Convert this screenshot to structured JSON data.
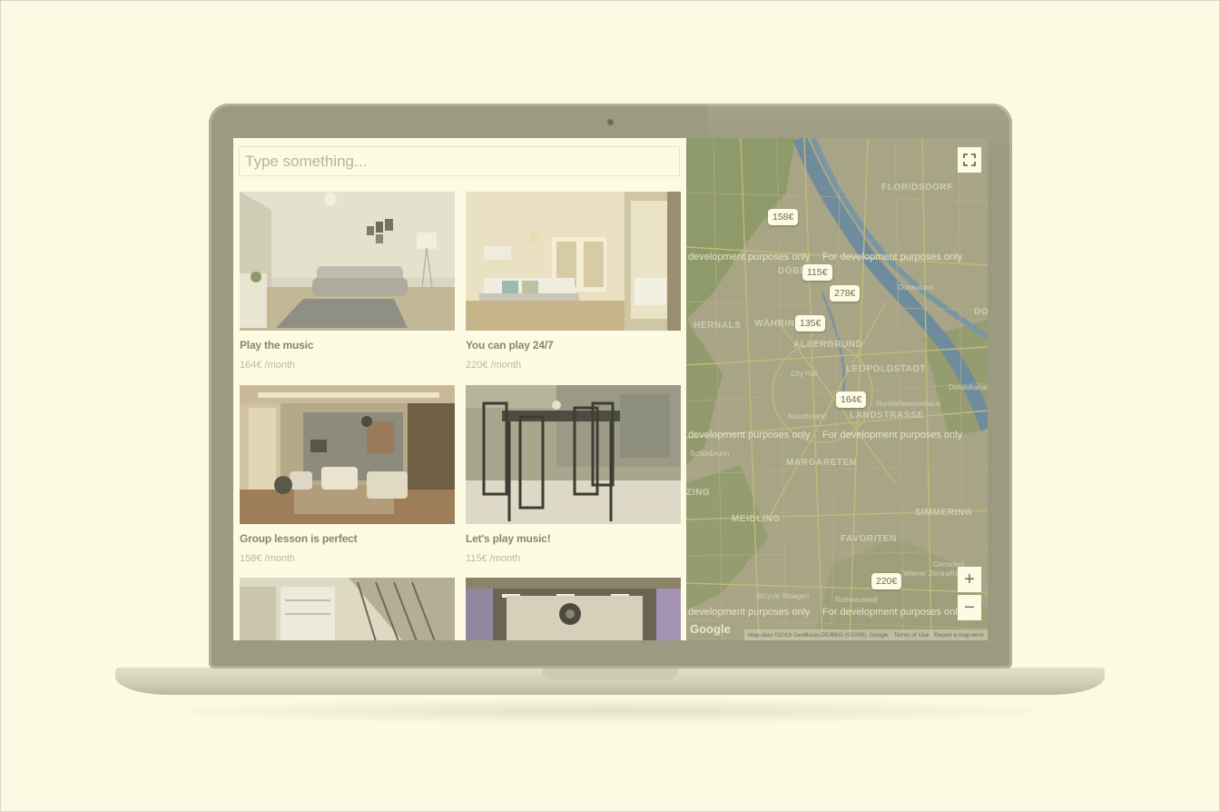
{
  "search": {
    "placeholder": "Type something..."
  },
  "listings": [
    {
      "title": "Play the music",
      "price": "164€ /month"
    },
    {
      "title": "You can play 24/7",
      "price": "220€ /month"
    },
    {
      "title": "Group lesson is perfect",
      "price": "158€ /month"
    },
    {
      "title": "Let's play music!",
      "price": "115€ /month"
    }
  ],
  "map": {
    "districts": [
      "FLORIDSDORF",
      "HERNALS",
      "WÄHRING",
      "ALSERGRUND",
      "LEOPOLDSTADT",
      "LANDSTRASSE",
      "MARGARETEN",
      "MEIDLING",
      "FAVORITEN",
      "SIMMERING",
      "DÖBLING",
      "ZING",
      "DO"
    ],
    "places": [
      "Donauturm",
      "City Hall",
      "Hundertwasserhaus",
      "Naschmarkt",
      "Schönbrunn",
      "Donaukanal",
      "Bicycle Waagen",
      "Rothneusiedl",
      "Wiener Zentralfriedhof",
      "Cemetery"
    ],
    "dev_text": "For development purposes only",
    "dev_text_partial": "development purposes only",
    "price_pins": [
      "158€",
      "115€",
      "278€",
      "135€",
      "164€",
      "220€"
    ],
    "google_logo": "Google",
    "attribution": [
      "Map data ©2019 GeoBasis-DE/BKG (©2009), Google",
      "Terms of Use",
      "Report a map error"
    ],
    "fullscreen_icon": "fullscreen-icon",
    "zoom_in": "+",
    "zoom_out": "−"
  }
}
